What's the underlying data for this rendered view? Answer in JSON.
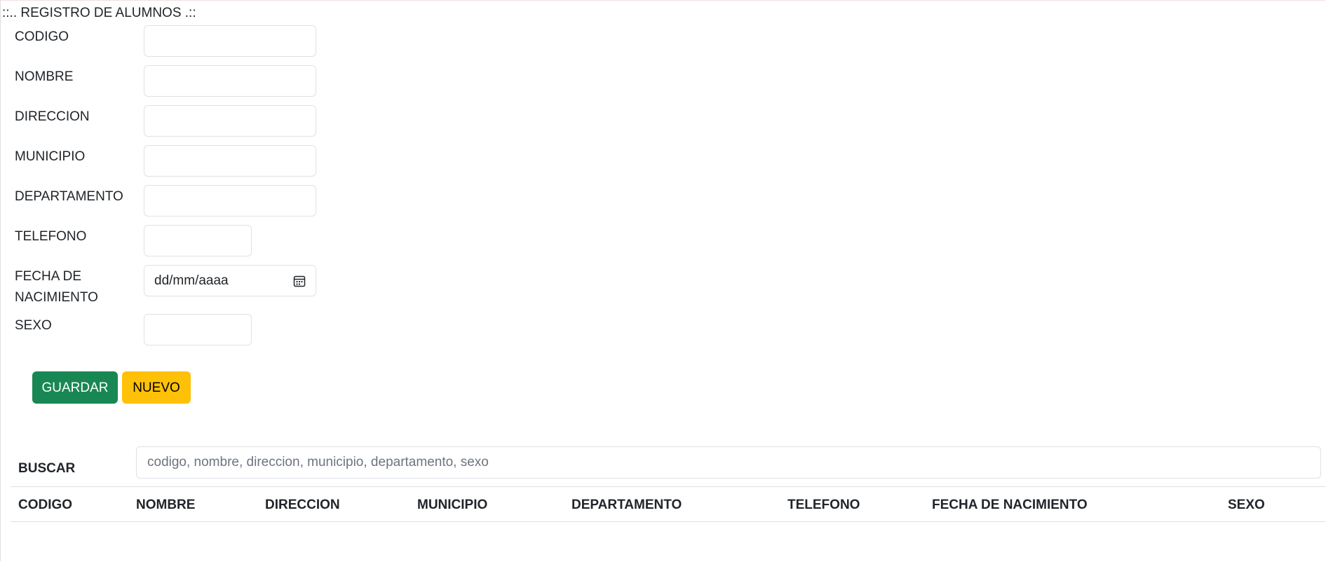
{
  "form": {
    "title": "::.. REGISTRO DE ALUMNOS .::",
    "fields": [
      {
        "label": "CODIGO",
        "value": ""
      },
      {
        "label": "NOMBRE",
        "value": ""
      },
      {
        "label": "DIRECCION",
        "value": ""
      },
      {
        "label": "MUNICIPIO",
        "value": ""
      },
      {
        "label": "DEPARTAMENTO",
        "value": ""
      },
      {
        "label": "TELEFONO",
        "value": ""
      },
      {
        "label": "FECHA DE NACIMIENTO",
        "value": "",
        "placeholder": "dd/mm/aaaa"
      },
      {
        "label": "SEXO",
        "value": ""
      }
    ],
    "buttons": {
      "save_label": "GUARDAR",
      "new_label": "NUEVO"
    },
    "colors": {
      "save": "#198754",
      "new": "#ffc107"
    }
  },
  "search": {
    "label": "BUSCAR",
    "placeholder": "codigo, nombre, direccion, municipio, departamento, sexo",
    "value": ""
  },
  "table": {
    "headers": [
      "CODIGO",
      "NOMBRE",
      "DIRECCION",
      "MUNICIPIO",
      "DEPARTAMENTO",
      "TELEFONO",
      "FECHA DE NACIMIENTO",
      "SEXO"
    ],
    "rows": []
  },
  "icons": {
    "date_picker": "calendar-icon"
  }
}
